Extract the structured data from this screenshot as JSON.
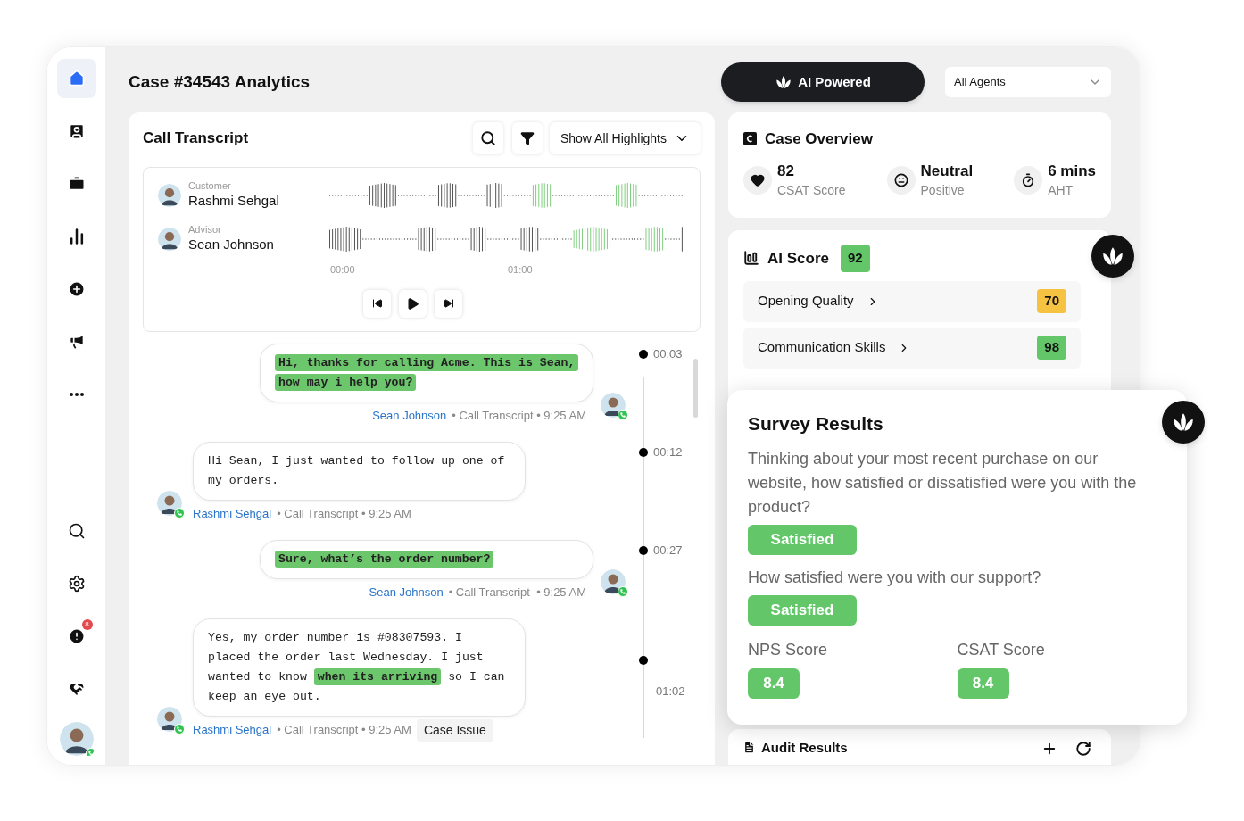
{
  "sidebar": {
    "top": [
      {
        "kind": "home",
        "selected": true
      },
      {
        "kind": "contacts",
        "selected": false
      },
      {
        "kind": "briefcase",
        "selected": false
      },
      {
        "kind": "chart",
        "selected": false
      },
      {
        "kind": "add",
        "selected": false
      },
      {
        "kind": "megaphone",
        "selected": false
      },
      {
        "kind": "more",
        "selected": false
      }
    ],
    "bottom": [
      {
        "kind": "search",
        "selected": false
      },
      {
        "kind": "settings",
        "selected": false
      },
      {
        "kind": "alert",
        "selected": false,
        "badge": "8"
      },
      {
        "kind": "heart",
        "selected": false
      },
      {
        "kind": "profile",
        "selected": false
      }
    ]
  },
  "header": {
    "title": "Case #34543 Analytics",
    "ai_button": "AI Powered",
    "agent_filter": "All Agents"
  },
  "transcript": {
    "title": "Call Transcript",
    "highlight_filter": "Show All Highlights",
    "participants": [
      {
        "role": "Customer",
        "name": "Rashmi Sehgal"
      },
      {
        "role": "Advisor",
        "name": "Sean Johnson"
      }
    ],
    "time_labels": [
      "00:00",
      "01:00"
    ],
    "controls": [
      {
        "kind": "previous"
      },
      {
        "kind": "play"
      },
      {
        "kind": "next"
      }
    ],
    "messages": [
      {
        "kind": "agent",
        "parts": [
          {
            "text": "Hi, thanks for calling Acme. This is Sean, how may i help you?",
            "highlighted": true
          }
        ],
        "author": "Sean Johnson",
        "meta": "• Call Transcript • 9:25 AM",
        "marker": "00:03"
      },
      {
        "kind": "customer",
        "parts": [
          {
            "text": "Hi Sean, I just wanted to follow up one of my orders.",
            "highlighted": false
          }
        ],
        "author": "Rashmi Sehgal",
        "meta": "• Call Transcript • 9:25 AM",
        "marker": "00:12"
      },
      {
        "kind": "agent",
        "parts": [
          {
            "text": "Sure, what’s the order number?",
            "highlighted": true
          }
        ],
        "author": "Sean Johnson",
        "meta": "• Call Transcript  • 9:25 AM",
        "marker": "00:27"
      },
      {
        "kind": "customer",
        "parts": [
          {
            "text": "Yes, my order number is #08307593. I placed the order last Wednesday. I just wanted to know ",
            "highlighted": false
          },
          {
            "text": "when its arriving",
            "highlighted": true
          },
          {
            "text": " so I can keep an eye out.",
            "highlighted": false
          }
        ],
        "author": "Rashmi Sehgal",
        "meta": "• Call Transcript • 9:25 AM",
        "tag": "Case Issue",
        "end_marker": "01:02"
      }
    ]
  },
  "case_overview": {
    "title": "Case Overview",
    "stats": [
      {
        "kind": "heart",
        "value": "82",
        "label": "CSAT Score"
      },
      {
        "kind": "sentiment",
        "value": "Neutral",
        "label": "Positive"
      },
      {
        "kind": "timer",
        "value": "6 mins",
        "label": "AHT"
      }
    ]
  },
  "ai_score": {
    "title": "AI Score",
    "score": "92",
    "rows": [
      {
        "label": "Opening Quality",
        "score": "70",
        "color": "#f5c242"
      },
      {
        "label": "Communication Skills",
        "score": "98",
        "color": "#63c76a"
      }
    ]
  },
  "survey": {
    "title": "Survey Results",
    "questions": [
      {
        "text": "Thinking about your most recent purchase on our website, how satisfied or dissatisfied were you with the product?",
        "answer": "Satisfied"
      },
      {
        "text": "How satisfied were you with our support?",
        "answer": "Satisfied"
      }
    ],
    "scores": [
      {
        "label": "NPS Score",
        "value": "8.4"
      },
      {
        "label": "CSAT Score",
        "value": "8.4"
      }
    ]
  },
  "audit": {
    "title": "Audit Results",
    "actions": [
      {
        "kind": "add"
      },
      {
        "kind": "refresh"
      }
    ]
  }
}
